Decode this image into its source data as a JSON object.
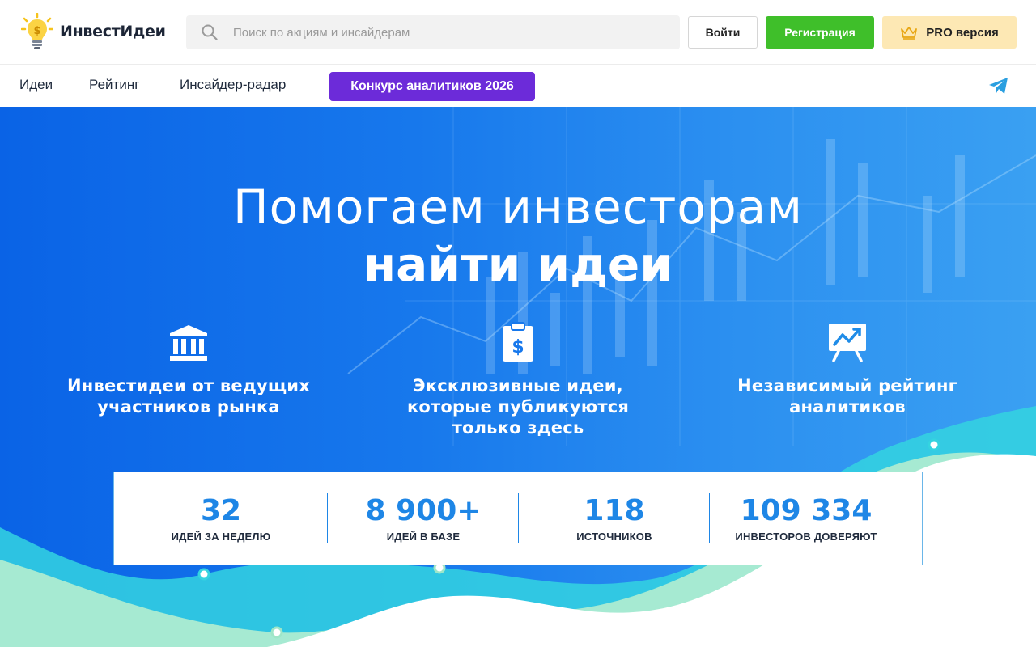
{
  "header": {
    "logo_text": "ИнвестИдеи",
    "search_placeholder": "Поиск по акциям и инсайдерам",
    "login_label": "Войти",
    "register_label": "Регистрация",
    "pro_label": "PRO версия"
  },
  "nav": {
    "items": [
      "Идеи",
      "Рейтинг",
      "Инсайдер-радар"
    ],
    "contest_label": "Конкурс аналитиков 2026"
  },
  "hero": {
    "title_line1": "Помогаем инвесторам",
    "title_line2": "найти идеи",
    "features": [
      {
        "icon": "bank-icon",
        "text": "Инвестидеи от ведущих участников рынка"
      },
      {
        "icon": "dollar-clipboard-icon",
        "text": "Эксклюзивные идеи, которые публикуются только здесь"
      },
      {
        "icon": "chart-board-icon",
        "text": "Независимый рейтинг аналитиков"
      }
    ]
  },
  "stats": [
    {
      "value": "32",
      "label": "ИДЕЙ ЗА НЕДЕЛЮ"
    },
    {
      "value": "8 900+",
      "label": "ИДЕЙ В БАЗЕ"
    },
    {
      "value": "118",
      "label": "ИСТОЧНИКОВ"
    },
    {
      "value": "109 334",
      "label": "ИНВЕСТОРОВ ДОВЕРЯЮТ"
    }
  ],
  "colors": {
    "brand_blue": "#1e86e6",
    "register_green": "#3fbf2a",
    "pro_bg": "#fde8b4",
    "contest_purple": "#6c2bd9",
    "telegram_blue": "#2a9fe0"
  }
}
